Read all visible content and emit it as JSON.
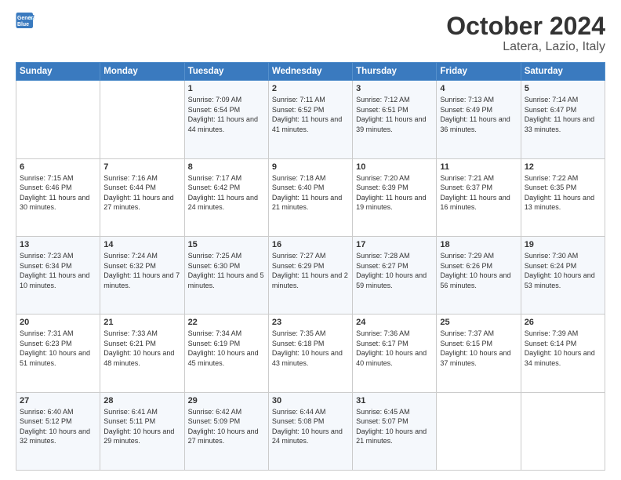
{
  "logo": {
    "line1": "General",
    "line2": "Blue"
  },
  "title": "October 2024",
  "subtitle": "Latera, Lazio, Italy",
  "weekdays": [
    "Sunday",
    "Monday",
    "Tuesday",
    "Wednesday",
    "Thursday",
    "Friday",
    "Saturday"
  ],
  "weeks": [
    [
      {
        "day": "",
        "info": ""
      },
      {
        "day": "",
        "info": ""
      },
      {
        "day": "1",
        "info": "Sunrise: 7:09 AM\nSunset: 6:54 PM\nDaylight: 11 hours and 44 minutes."
      },
      {
        "day": "2",
        "info": "Sunrise: 7:11 AM\nSunset: 6:52 PM\nDaylight: 11 hours and 41 minutes."
      },
      {
        "day": "3",
        "info": "Sunrise: 7:12 AM\nSunset: 6:51 PM\nDaylight: 11 hours and 39 minutes."
      },
      {
        "day": "4",
        "info": "Sunrise: 7:13 AM\nSunset: 6:49 PM\nDaylight: 11 hours and 36 minutes."
      },
      {
        "day": "5",
        "info": "Sunrise: 7:14 AM\nSunset: 6:47 PM\nDaylight: 11 hours and 33 minutes."
      }
    ],
    [
      {
        "day": "6",
        "info": "Sunrise: 7:15 AM\nSunset: 6:46 PM\nDaylight: 11 hours and 30 minutes."
      },
      {
        "day": "7",
        "info": "Sunrise: 7:16 AM\nSunset: 6:44 PM\nDaylight: 11 hours and 27 minutes."
      },
      {
        "day": "8",
        "info": "Sunrise: 7:17 AM\nSunset: 6:42 PM\nDaylight: 11 hours and 24 minutes."
      },
      {
        "day": "9",
        "info": "Sunrise: 7:18 AM\nSunset: 6:40 PM\nDaylight: 11 hours and 21 minutes."
      },
      {
        "day": "10",
        "info": "Sunrise: 7:20 AM\nSunset: 6:39 PM\nDaylight: 11 hours and 19 minutes."
      },
      {
        "day": "11",
        "info": "Sunrise: 7:21 AM\nSunset: 6:37 PM\nDaylight: 11 hours and 16 minutes."
      },
      {
        "day": "12",
        "info": "Sunrise: 7:22 AM\nSunset: 6:35 PM\nDaylight: 11 hours and 13 minutes."
      }
    ],
    [
      {
        "day": "13",
        "info": "Sunrise: 7:23 AM\nSunset: 6:34 PM\nDaylight: 11 hours and 10 minutes."
      },
      {
        "day": "14",
        "info": "Sunrise: 7:24 AM\nSunset: 6:32 PM\nDaylight: 11 hours and 7 minutes."
      },
      {
        "day": "15",
        "info": "Sunrise: 7:25 AM\nSunset: 6:30 PM\nDaylight: 11 hours and 5 minutes."
      },
      {
        "day": "16",
        "info": "Sunrise: 7:27 AM\nSunset: 6:29 PM\nDaylight: 11 hours and 2 minutes."
      },
      {
        "day": "17",
        "info": "Sunrise: 7:28 AM\nSunset: 6:27 PM\nDaylight: 10 hours and 59 minutes."
      },
      {
        "day": "18",
        "info": "Sunrise: 7:29 AM\nSunset: 6:26 PM\nDaylight: 10 hours and 56 minutes."
      },
      {
        "day": "19",
        "info": "Sunrise: 7:30 AM\nSunset: 6:24 PM\nDaylight: 10 hours and 53 minutes."
      }
    ],
    [
      {
        "day": "20",
        "info": "Sunrise: 7:31 AM\nSunset: 6:23 PM\nDaylight: 10 hours and 51 minutes."
      },
      {
        "day": "21",
        "info": "Sunrise: 7:33 AM\nSunset: 6:21 PM\nDaylight: 10 hours and 48 minutes."
      },
      {
        "day": "22",
        "info": "Sunrise: 7:34 AM\nSunset: 6:19 PM\nDaylight: 10 hours and 45 minutes."
      },
      {
        "day": "23",
        "info": "Sunrise: 7:35 AM\nSunset: 6:18 PM\nDaylight: 10 hours and 43 minutes."
      },
      {
        "day": "24",
        "info": "Sunrise: 7:36 AM\nSunset: 6:17 PM\nDaylight: 10 hours and 40 minutes."
      },
      {
        "day": "25",
        "info": "Sunrise: 7:37 AM\nSunset: 6:15 PM\nDaylight: 10 hours and 37 minutes."
      },
      {
        "day": "26",
        "info": "Sunrise: 7:39 AM\nSunset: 6:14 PM\nDaylight: 10 hours and 34 minutes."
      }
    ],
    [
      {
        "day": "27",
        "info": "Sunrise: 6:40 AM\nSunset: 5:12 PM\nDaylight: 10 hours and 32 minutes."
      },
      {
        "day": "28",
        "info": "Sunrise: 6:41 AM\nSunset: 5:11 PM\nDaylight: 10 hours and 29 minutes."
      },
      {
        "day": "29",
        "info": "Sunrise: 6:42 AM\nSunset: 5:09 PM\nDaylight: 10 hours and 27 minutes."
      },
      {
        "day": "30",
        "info": "Sunrise: 6:44 AM\nSunset: 5:08 PM\nDaylight: 10 hours and 24 minutes."
      },
      {
        "day": "31",
        "info": "Sunrise: 6:45 AM\nSunset: 5:07 PM\nDaylight: 10 hours and 21 minutes."
      },
      {
        "day": "",
        "info": ""
      },
      {
        "day": "",
        "info": ""
      }
    ]
  ]
}
